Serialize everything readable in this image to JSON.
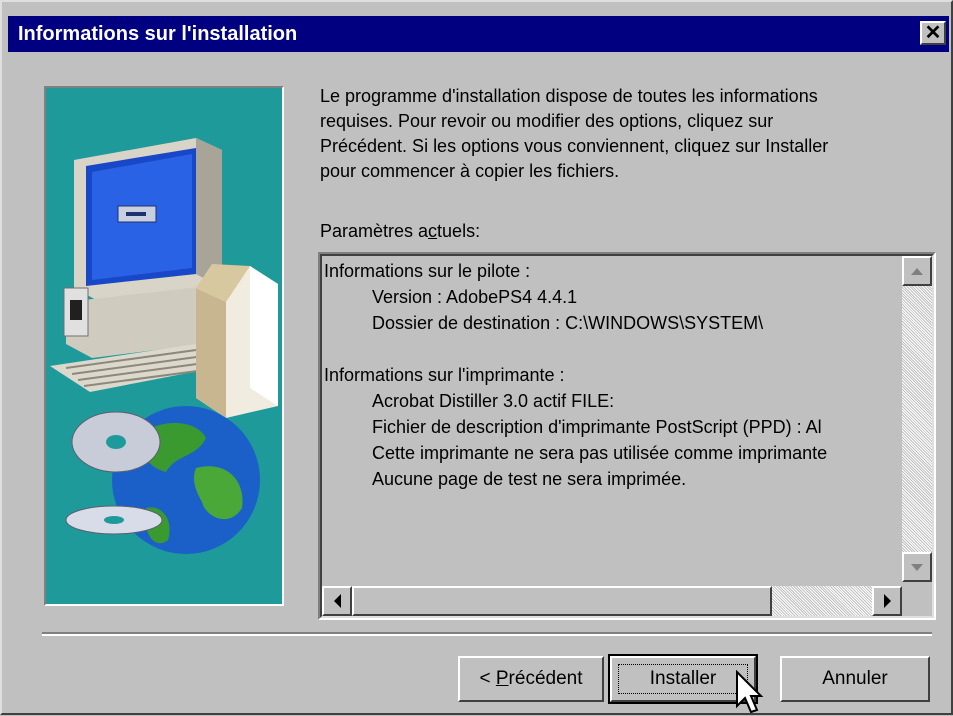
{
  "window": {
    "title": "Informations sur l'installation",
    "close_label": "✕"
  },
  "intro": {
    "lines": [
      "Le programme d'installation dispose de toutes les informations",
      "requises. Pour revoir ou modifier des options, cliquez sur",
      "Précédent. Si les options vous conviennent, cliquez sur Installer",
      "pour commencer à copier les fichiers."
    ]
  },
  "params": {
    "label_prefix": "Paramètres a",
    "label_accel": "c",
    "label_suffix": "tuels:",
    "driver_heading": "Informations sur le pilote :",
    "driver_version": "Version : AdobePS4 4.4.1",
    "driver_dest": "Dossier de destination : C:\\WINDOWS\\SYSTEM\\",
    "printer_heading": "Informations sur l'imprimante :",
    "printer_name": "Acrobat Distiller 3.0 actif FILE:",
    "printer_ppd": "Fichier de description d'imprimante PostScript (PPD) : Al",
    "printer_default": "Cette imprimante ne sera pas utilisée comme imprimante",
    "printer_test": "Aucune page de test ne sera imprimée."
  },
  "buttons": {
    "back_prefix": "< ",
    "back_accel": "P",
    "back_suffix": "récédent",
    "install": "Installer",
    "cancel": "Annuler"
  },
  "colors": {
    "titlebar": "#000080",
    "face": "#c0c0c0",
    "art_background": "#1e9a9a"
  }
}
